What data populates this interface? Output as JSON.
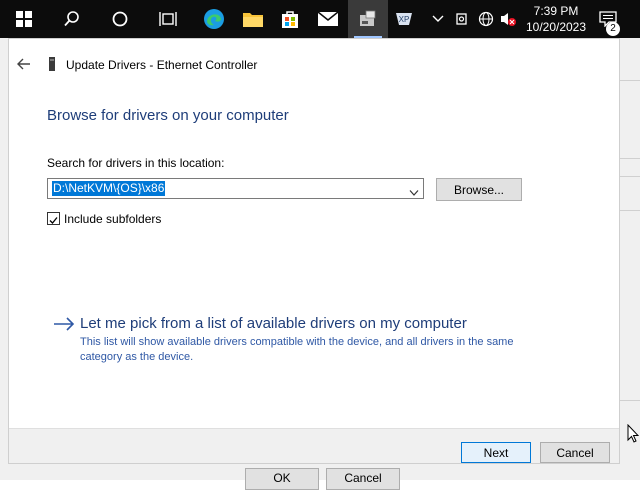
{
  "taskbar": {
    "clock_time": "7:39 PM",
    "clock_date": "10/20/2023",
    "notification_count": "2",
    "icons": [
      "windows-start-icon",
      "search-icon",
      "cortana-icon",
      "task-view-icon",
      "edge-icon",
      "file-explorer-icon",
      "store-icon",
      "mail-icon",
      "device-manager-icon",
      "remote-icon",
      "chevron-up-icon",
      "network-icon",
      "language-icon",
      "volume-muted-icon",
      "notifications-icon"
    ]
  },
  "background": {
    "ok_label": "OK",
    "cancel_label": "Cancel"
  },
  "dialog": {
    "title": "Update Drivers - Ethernet Controller",
    "heading": "Browse for drivers on your computer",
    "location_label": "Search for drivers in this location:",
    "location_value": "D:\\NetKVM\\{OS}\\x86",
    "browse_label": "Browse...",
    "include_subfolders_label": "Include subfolders",
    "include_subfolders_checked": true,
    "pick_title": "Let me pick from a list of available drivers on my computer",
    "pick_description": "This list will show available drivers compatible with the device, and all drivers in the same category as the device.",
    "next_label": "Next",
    "cancel_label": "Cancel"
  },
  "colors": {
    "accent": "#0078d7",
    "heading": "#1e3d79",
    "link_desc": "#2f58a5",
    "taskbar": "#0c0c0c"
  }
}
